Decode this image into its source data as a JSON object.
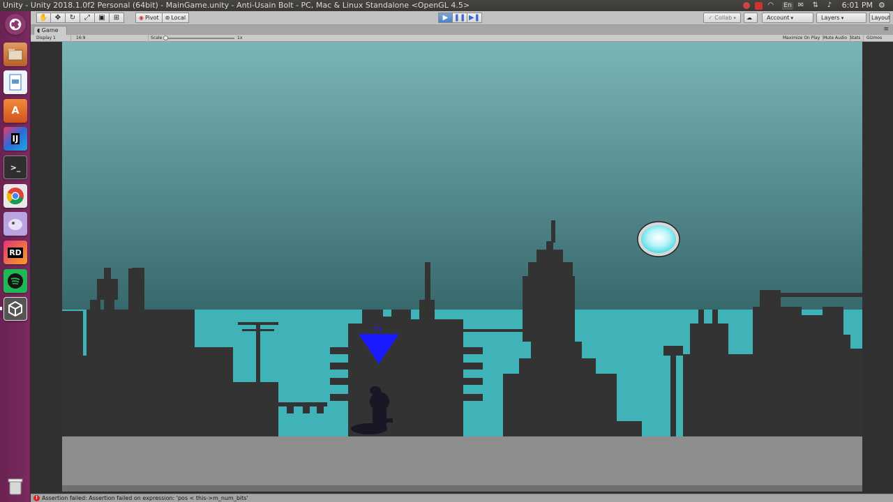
{
  "window": {
    "title": "Unity - Unity 2018.1.0f2 Personal (64bit) - MainGame.unity - Anti-Usain Bolt - PC, Mac & Linux Standalone <OpenGL 4.5>"
  },
  "system_tray": {
    "language": "En",
    "time": "6:01 PM",
    "icons": [
      "record-icon",
      "app-indicator-icon",
      "wifi-icon",
      "keyboard-lang-icon",
      "mail-icon",
      "network-icon",
      "volume-icon",
      "settings-icon"
    ]
  },
  "launcher": {
    "items": [
      {
        "name": "ubuntu-dash",
        "icon": "ubuntu-logo-icon",
        "color": "#7a2a5f"
      },
      {
        "name": "files",
        "icon": "file-manager-icon",
        "color": "#d07a3a"
      },
      {
        "name": "text-editor",
        "icon": "document-icon",
        "color": "#4a88c8"
      },
      {
        "name": "software-center",
        "icon": "software-center-icon",
        "color": "#e0652a",
        "label": "A"
      },
      {
        "name": "intellij",
        "icon": "intellij-icon",
        "color": "#1b5aa8",
        "label": "IJ"
      },
      {
        "name": "terminal",
        "icon": "terminal-icon",
        "color": "#2b2b2b",
        "label": ">_"
      },
      {
        "name": "chrome",
        "icon": "chrome-icon",
        "color": "#e6e6e6"
      },
      {
        "name": "pidgin",
        "icon": "chat-bird-icon",
        "color": "#9a7cc9"
      },
      {
        "name": "rider",
        "icon": "rider-icon",
        "color": "#c01a4a",
        "label": "RD"
      },
      {
        "name": "spotify",
        "icon": "spotify-icon",
        "color": "#1db954"
      },
      {
        "name": "unity",
        "icon": "unity-icon",
        "color": "#444444"
      },
      {
        "name": "trash",
        "icon": "trash-icon",
        "color": "#666666"
      }
    ]
  },
  "toolbar": {
    "pivot_label": "Pivot",
    "local_label": "Local",
    "collab_label": "Collab",
    "account_label": "Account",
    "layers_label": "Layers",
    "layout_label": "Layout"
  },
  "game_view": {
    "tab_label": "Game",
    "display_label": "Display 1",
    "aspect_label": "16:9",
    "scale_label": "Scale",
    "scale_value": "1x",
    "maximize_label": "Maximize On Play",
    "mute_label": "Mute Audio",
    "stats_label": "Stats",
    "gizmos_label": "Gizmos",
    "player_tag": "P1"
  },
  "console": {
    "message": "Assertion failed: Assertion failed on expression: 'pos < this->m_num_bits'"
  },
  "colors": {
    "sky_top": "#7bb5b8",
    "sky_bottom": "#3a6e72",
    "water": "#3fb3b8",
    "silhouette": "#333333",
    "ground": "#8e8e8e",
    "marker": "#1a1aff",
    "orb": "#c8f6f8"
  }
}
